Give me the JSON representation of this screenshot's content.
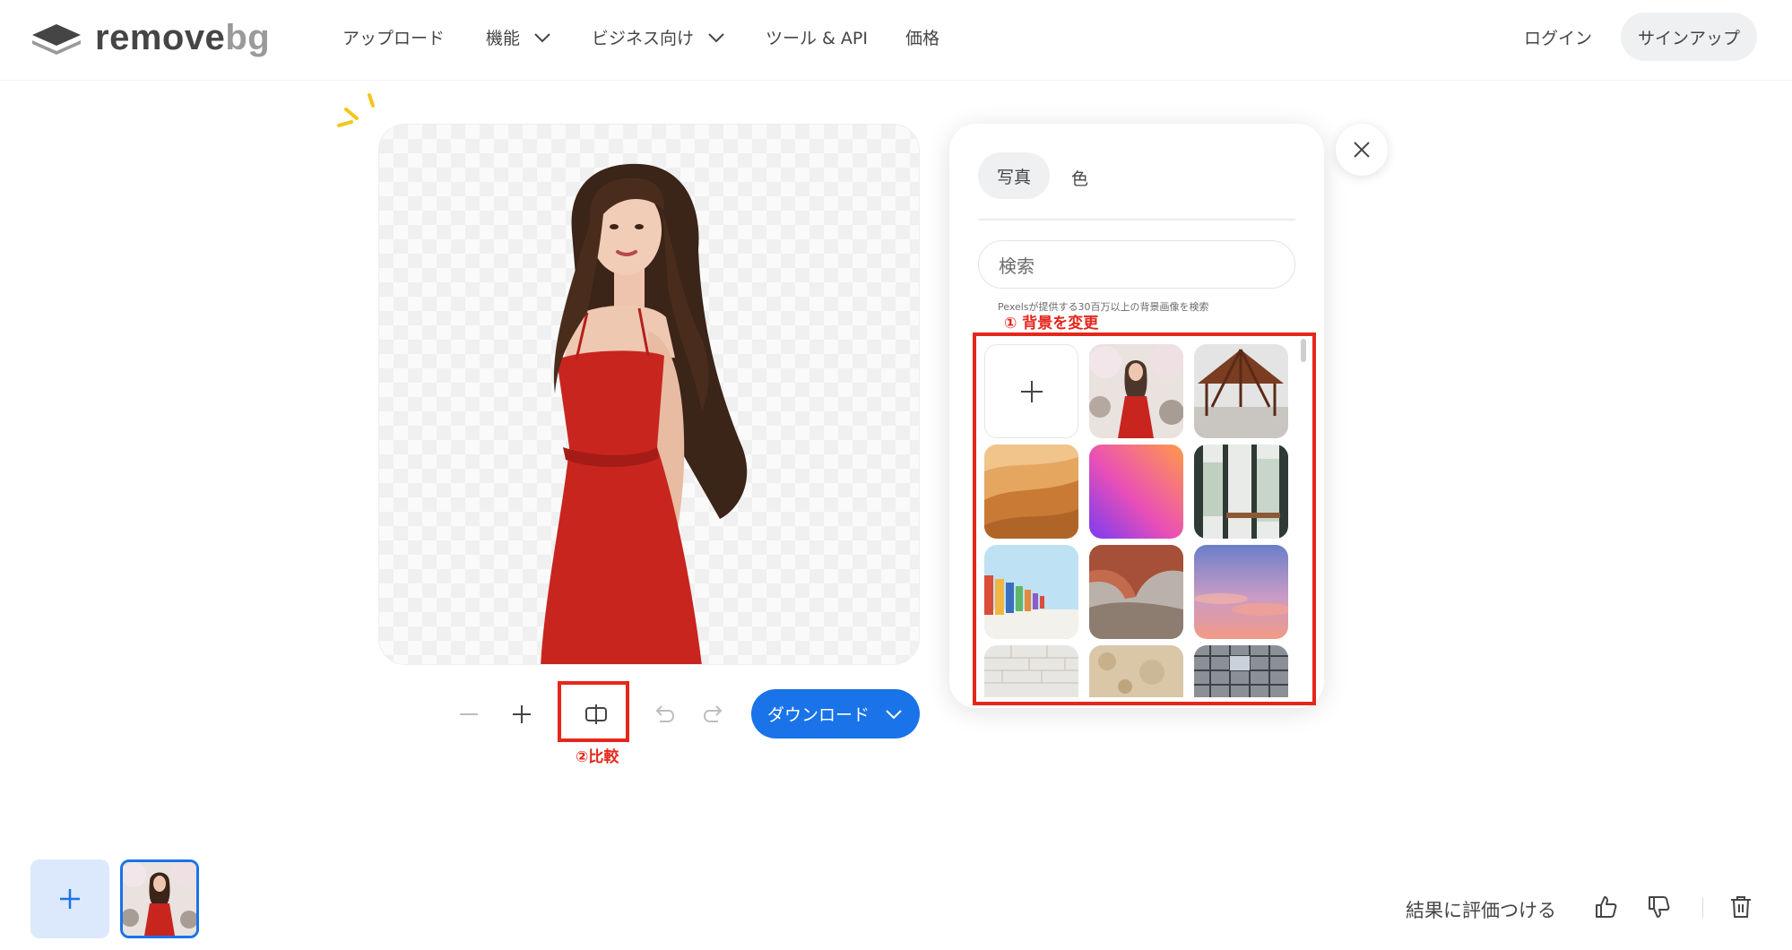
{
  "app": {
    "logo_text": "remove",
    "logo_text_suffix": "bg"
  },
  "nav": {
    "items": [
      {
        "label": "アップロード",
        "has_dropdown": false
      },
      {
        "label": "機能",
        "has_dropdown": true
      },
      {
        "label": "ビジネス向け",
        "has_dropdown": true
      },
      {
        "label": "ツール & API",
        "has_dropdown": false
      },
      {
        "label": "価格",
        "has_dropdown": false
      }
    ],
    "login_label": "ログイン",
    "signup_label": "サインアップ"
  },
  "editor": {
    "toolbar": {
      "zoom_out_icon": "minus-icon",
      "zoom_in_icon": "plus-icon",
      "compare_icon": "compare-icon",
      "undo_icon": "undo-icon",
      "redo_icon": "redo-icon"
    },
    "compare_annotation": "②比較",
    "download_label": "ダウンロード"
  },
  "background_panel": {
    "tabs": [
      {
        "label": "写真",
        "active": true
      },
      {
        "label": "色",
        "active": false
      }
    ],
    "search_placeholder": "検索",
    "search_hint": "Pexelsが提供する30百万以上の背景画像を検索",
    "change_annotation": "① 背景を変更",
    "thumbnails": [
      "add-icon",
      "woman-in-red-dress-cherry-blossoms",
      "wooden-gazebo-structure",
      "desert-dunes",
      "pink-purple-gradient",
      "cafe-window-interior",
      "colorful-beach-huts",
      "red-rock-arch",
      "pink-sunset-sky",
      "white-brick-wall",
      "beige-stone-texture",
      "glass-building"
    ]
  },
  "bottom_bar": {
    "rate_label": "結果に評価つける",
    "add_icon": "plus-icon",
    "thumbs_up_icon": "thumbs-up-icon",
    "thumbs_down_icon": "thumbs-down-icon",
    "trash_icon": "trash-icon"
  },
  "colors": {
    "accent": "#1a73e8",
    "annotation_red": "#e5261b",
    "text": "#454545"
  }
}
